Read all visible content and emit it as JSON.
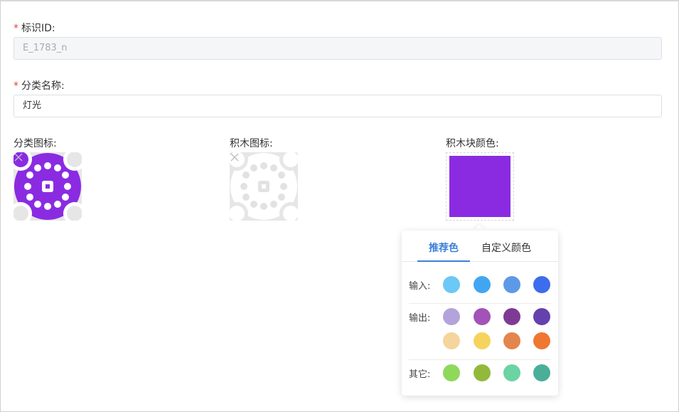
{
  "form": {
    "id_label": "标识ID:",
    "id_value": "E_1783_n",
    "name_label": "分类名称:",
    "name_value": "灯光",
    "category_icon_label": "分类图标:",
    "block_icon_label": "积木图标:",
    "block_color_label": "积木块颜色:",
    "required_mark": "*"
  },
  "colors": {
    "selected_block_color": "#8a2be2",
    "category_icon_color": "#8a2be2",
    "accent": "#3b7fd9"
  },
  "picker": {
    "tabs": [
      {
        "label": "推荐色",
        "active": true
      },
      {
        "label": "自定义颜色",
        "active": false
      }
    ],
    "groups": [
      {
        "label": "输入:",
        "rows": [
          [
            "#6cc8f5",
            "#41a6f1",
            "#5e99e8",
            "#3d6cec"
          ]
        ]
      },
      {
        "label": "输出:",
        "rows": [
          [
            "#b3a3da",
            "#a352b6",
            "#7f3a96",
            "#6441ad"
          ],
          [
            "#f5d59d",
            "#f6d35c",
            "#e4854e",
            "#ef7731"
          ]
        ]
      },
      {
        "label": "其它:",
        "rows": [
          [
            "#8ed85a",
            "#93b93c",
            "#6cd3a3",
            "#4aae99"
          ]
        ]
      }
    ]
  }
}
